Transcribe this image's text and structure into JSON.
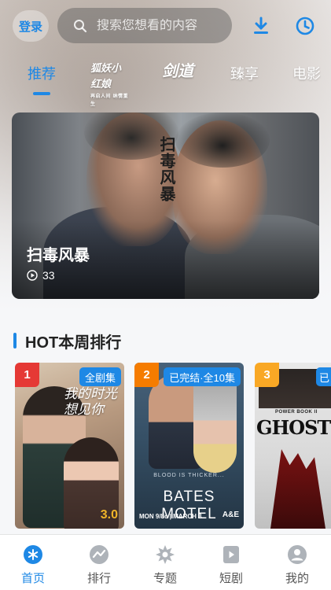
{
  "header": {
    "login_label": "登录",
    "search_placeholder": "搜索您想看的内容"
  },
  "tabs": [
    {
      "label": "推荐",
      "active": true
    },
    {
      "label": "",
      "logo_text": "狐妖小红娘",
      "logo_sub": "再启人间 纳情重生"
    },
    {
      "label": "",
      "logo_text": "剑道"
    },
    {
      "label": "臻享"
    },
    {
      "label": "电影"
    }
  ],
  "banner": {
    "title": "扫毒风暴",
    "art_title": "扫毒风暴",
    "views": "33"
  },
  "section": {
    "title": "HOT本周排行"
  },
  "posters": [
    {
      "rank": "1",
      "rank_color": "#e53935",
      "badge": "全剧集",
      "score": "3.0",
      "art_text": "我的时光 想见你"
    },
    {
      "rank": "2",
      "rank_color": "#f57c00",
      "badge": "已完结·全10集",
      "tagline": "BLOOD IS THICKER...",
      "title": "BATES MOTEL",
      "date": "MON 9/8c | MARCH 3",
      "network": "A&E"
    },
    {
      "rank": "3",
      "rank_color": "#f9a825",
      "badge": "已",
      "brand": "POWER BOOK II",
      "title": "GHOST"
    }
  ],
  "bottom_nav": [
    {
      "label": "首页",
      "icon": "home-icon",
      "active": true
    },
    {
      "label": "排行",
      "icon": "ranking-icon",
      "active": false
    },
    {
      "label": "专题",
      "icon": "topic-icon",
      "active": false
    },
    {
      "label": "短剧",
      "icon": "short-drama-icon",
      "active": false
    },
    {
      "label": "我的",
      "icon": "profile-icon",
      "active": false
    }
  ],
  "colors": {
    "accent": "#1e88e5",
    "rank1": "#e53935",
    "rank2": "#f57c00",
    "rank3": "#f9a825",
    "score": "#f0b429"
  }
}
